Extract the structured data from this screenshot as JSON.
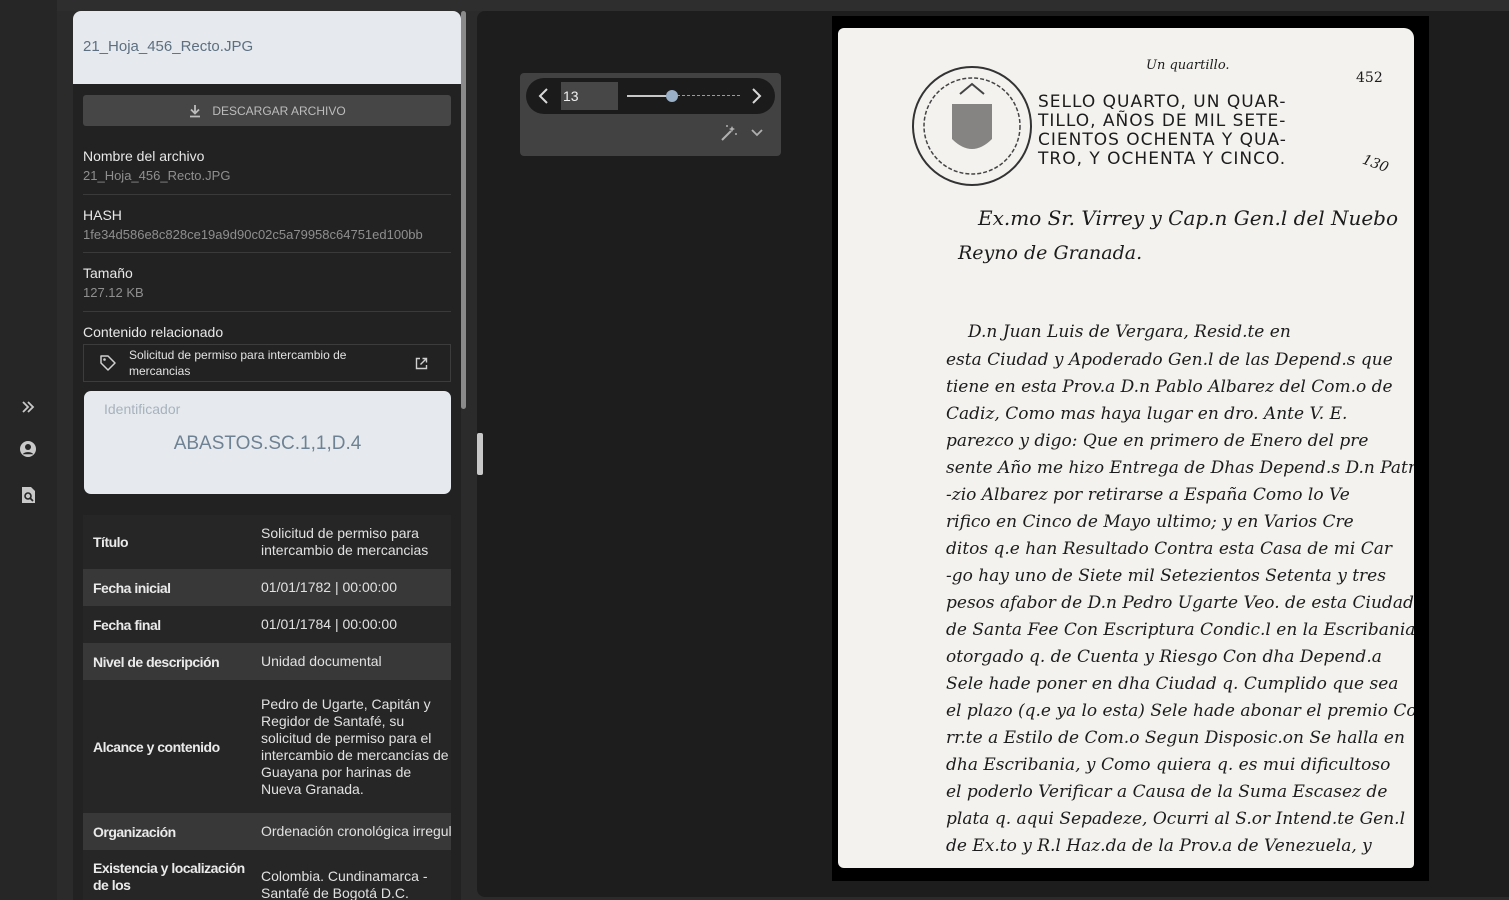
{
  "sidebar": {
    "filename": "21_Hoja_456_Recto.JPG",
    "download_label": "DESCARGAR ARCHIVO",
    "meta": [
      {
        "label": "Nombre del archivo",
        "value": "21_Hoja_456_Recto.JPG"
      },
      {
        "label": "HASH",
        "value": "1fe34d586e8c828ce19a9d90c02c5a79958c64751ed100bb"
      },
      {
        "label": "Tamaño",
        "value": "127.12 KB"
      }
    ],
    "related_label": "Contenido relacionado",
    "related_item": "Solicitud de permiso para intercambio de mercancias",
    "identifier_label": "Identificador",
    "identifier_value": "ABASTOS.SC.1,1,D.4",
    "table": [
      {
        "key": "Título",
        "value": "Solicitud de permiso para intercambio de mercancias"
      },
      {
        "key": "Fecha inicial",
        "value": "01/01/1782 | 00:00:00"
      },
      {
        "key": "Fecha final",
        "value": "01/01/1784 | 00:00:00"
      },
      {
        "key": "Nivel de descripción",
        "value": "Unidad documental"
      },
      {
        "key": "Alcance y contenido",
        "value": "Pedro de Ugarte, Capitán y Regidor de Santafé, su solicitud de permiso para el intercambio de mercancías de Guayana por harinas de Nueva Granada."
      },
      {
        "key": "Organización",
        "value": "Ordenación cronológica irregular"
      },
      {
        "key": "Existencia y localización de los",
        "value": "Colombia. Cundinamarca - Santafé de Bogotá D.C. Archivo"
      }
    ]
  },
  "viewer": {
    "page": "13",
    "slider_fraction": 0.4
  },
  "document": {
    "header_top": "Un quartillo.",
    "page_number": "452",
    "seal_text_1": "SELLO QUARTO, UN QUAR-",
    "seal_text_2": "TILLO, AÑOS DE MIL SETE-",
    "seal_text_3": "CIENTOS OCHENTA Y QUA-",
    "seal_text_4": "TRO, Y OCHENTA Y CINCO.",
    "side_number": "130",
    "lines": [
      "Ex.mo Sr. Virrey y Cap.n Gen.l del Nuebo",
      "Reyno de Granada.",
      "D.n Juan Luis de Vergara, Resid.te en",
      "esta Ciudad y Apoderado Gen.l de las Depend.s que",
      "tiene en esta Prov.a D.n Pablo Albarez del Com.o de",
      "Cadiz, Como mas haya lugar en dro. Ante V. E.",
      "parezco y digo: Que en primero de Enero del pre",
      "sente Año me hizo Entrega de Dhas Depend.s D.n Patri",
      "-zio Albarez por retirarse a España Como lo Ve",
      "rifico en Cinco de Mayo ultimo; y en Varios Cre",
      "ditos q.e han Resultado Contra esta Casa de mi Car",
      "-go hay uno de Siete mil Setezientos Setenta y tres",
      "pesos afabor de D.n Pedro Ugarte Veo. de esta Ciudad",
      "de Santa Fee Con Escriptura Condic.l en la Escribania",
      "otorgado q. de Cuenta y Riesgo Con dha Depend.a",
      "Sele hade poner en dha Ciudad q. Cumplido que sea",
      "el plazo (q.e ya lo esta) Sele hade abonar el premio Co",
      "rr.te a Estilo de Com.o Segun Disposic.on Se halla en",
      "dha Escribania, y Como quiera q. es mui dificultoso",
      "el poderlo Verificar a Causa de la Suma Escasez de",
      "plata q. aqui Sepadeze, Ocurri al S.or Intend.te Gen.l",
      "de Ex.to y R.l Haz.da de la Prov.a de Venezuela, y"
    ]
  }
}
